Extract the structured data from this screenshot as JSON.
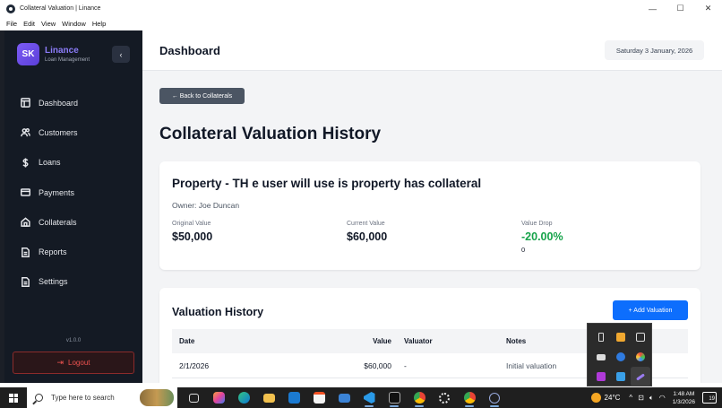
{
  "window": {
    "title": "Collateral Valuation | Linance",
    "minimize": "—",
    "maximize": "☐",
    "close": "✕"
  },
  "menu": [
    "File",
    "Edit",
    "View",
    "Window",
    "Help"
  ],
  "sidebar": {
    "logo_text": "SK",
    "brand_name": "Linance",
    "brand_sub": "Loan Management",
    "collapse_glyph": "‹",
    "items": [
      {
        "label": "Dashboard",
        "icon": "layout-icon"
      },
      {
        "label": "Customers",
        "icon": "users-icon"
      },
      {
        "label": "Loans",
        "icon": "dollar-icon"
      },
      {
        "label": "Payments",
        "icon": "card-icon"
      },
      {
        "label": "Collaterals",
        "icon": "home-icon"
      },
      {
        "label": "Reports",
        "icon": "file-icon"
      },
      {
        "label": "Settings",
        "icon": "file-icon"
      }
    ],
    "version": "v1.0.0",
    "logout_label": "Logout",
    "logout_glyph": "⇥"
  },
  "header": {
    "title": "Dashboard",
    "date": "Saturday 3 January, 2026"
  },
  "main": {
    "back_label": "← Back to Collaterals",
    "page_heading": "Collateral Valuation History",
    "property": {
      "title": "Property - TH e user will use is property has collateral",
      "owner": "Owner: Joe Duncan",
      "original_label": "Original Value",
      "original_value": "$50,000",
      "current_label": "Current Value",
      "current_value": "$60,000",
      "drop_label": "Value Drop",
      "drop_value": "-20.00%",
      "drop_extra": "0"
    },
    "history": {
      "title": "Valuation History",
      "add_label": "+ Add Valuation",
      "columns": [
        "Date",
        "Value",
        "Valuator",
        "Notes"
      ],
      "rows": [
        {
          "date": "2/1/2026",
          "value": "$60,000",
          "valuator": "-",
          "notes": "Initial valuation"
        }
      ]
    }
  },
  "taskbar": {
    "search_placeholder": "Type here to search",
    "temperature": "24°C",
    "time": "1:48 AM",
    "date": "1/3/2026",
    "notification_count": "19"
  },
  "colors": {
    "sidebar_bg": "#141a24",
    "brand_accent": "#8b7cf8",
    "primary_button": "#0d6efd",
    "back_button": "#4b5563",
    "drop_green": "#16a34a",
    "logout_red": "#ef5350"
  }
}
